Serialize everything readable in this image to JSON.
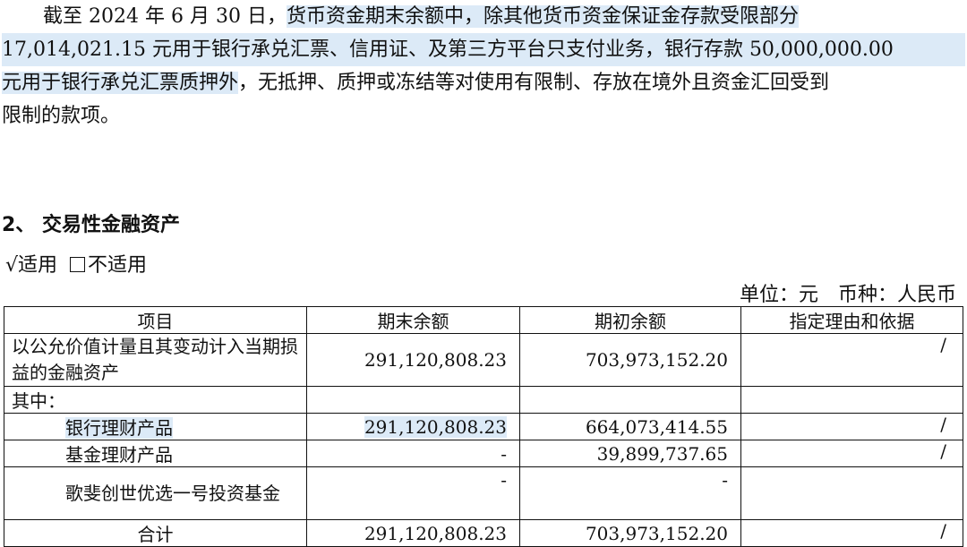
{
  "paragraph": {
    "line1_a": "截至 2024 年 6 月 30 日，",
    "line1_b": "货币资金期末余额中，除其他货币资金保证金存款受限部分",
    "line2": "17,014,021.15 元用于银行承兑汇票、信用证、及第三方平台只支付业务，银行存款 50,000,000.00",
    "line3_a": "元用于银行承兑汇票质押外",
    "line3_b": "，无抵押、质押或冻结等对使用有限制、存放在境外且资金汇回受到",
    "line4": "限制的款项。"
  },
  "section": {
    "heading": "2、 交易性金融资产",
    "applicable_check": "√",
    "applicable": "适用",
    "not_applicable": "不适用",
    "unit": "单位：元　币种：人民币"
  },
  "table": {
    "headers": [
      "项目",
      "期末余额",
      "期初余额",
      "指定理由和依据"
    ],
    "rows": [
      {
        "item": "以公允价值计量且其变动计入当期损益的金融资产",
        "end": "291,120,808.23",
        "begin": "703,973,152.20",
        "reason": "/"
      },
      {
        "item": "其中：",
        "end": "",
        "begin": "",
        "reason": ""
      },
      {
        "item": "银行理财产品",
        "end": "291,120,808.23",
        "begin": "664,073,414.55",
        "reason": "/"
      },
      {
        "item": "基金理财产品",
        "end": "-",
        "begin": "39,899,737.65",
        "reason": "/"
      },
      {
        "item": "歌斐创世优选一号投资基金",
        "end": "-",
        "begin": "-",
        "reason": ""
      },
      {
        "item": "合计",
        "end": "291,120,808.23",
        "begin": "703,973,152.20",
        "reason": "/"
      }
    ]
  }
}
